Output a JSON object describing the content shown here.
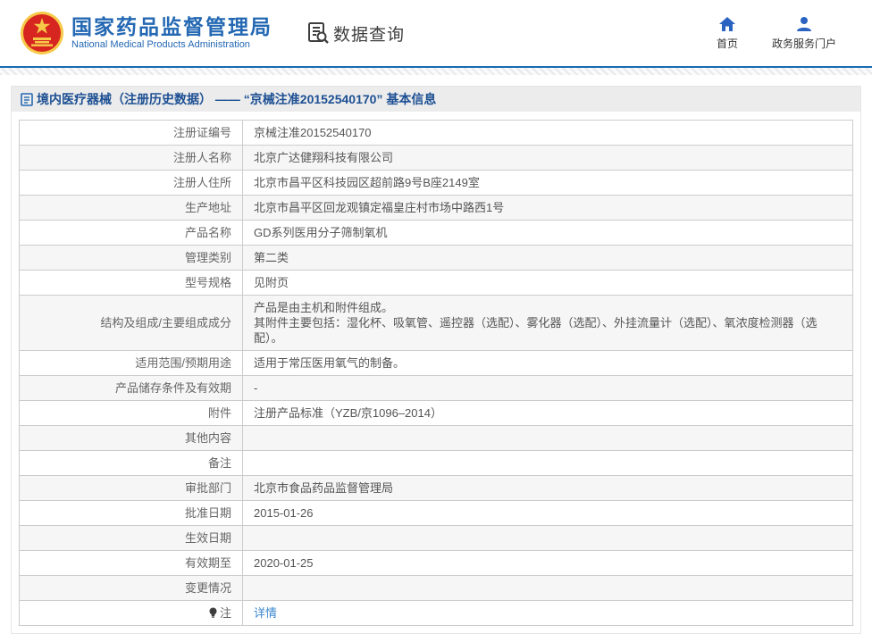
{
  "header": {
    "org_name_zh": "国家药品监督管理局",
    "org_name_en": "National Medical Products Administration",
    "section_title": "数据查询",
    "nav": [
      {
        "label": "首页",
        "icon": "home-icon"
      },
      {
        "label": "政务服务门户",
        "icon": "user-icon"
      }
    ]
  },
  "colors": {
    "brand_blue": "#2468b3",
    "divider_blue": "#1a6ab3",
    "title_blue": "#1c4f93",
    "link_blue": "#3a87cf",
    "emblem_red": "#d6261f",
    "emblem_gold": "#f7c948"
  },
  "page": {
    "title": "境内医疗器械（注册历史数据） —— “京械注准20152540170” 基本信息"
  },
  "table": {
    "rows": [
      {
        "label": "注册证编号",
        "values": [
          "京械注准20152540170"
        ]
      },
      {
        "label": "注册人名称",
        "values": [
          "北京广达健翔科技有限公司"
        ]
      },
      {
        "label": "注册人住所",
        "values": [
          "北京市昌平区科技园区超前路9号B座2149室"
        ]
      },
      {
        "label": "生产地址",
        "values": [
          "北京市昌平区回龙观镇定福皇庄村市场中路西1号"
        ]
      },
      {
        "label": "产品名称",
        "values": [
          "GD系列医用分子筛制氧机"
        ]
      },
      {
        "label": "管理类别",
        "values": [
          "第二类"
        ]
      },
      {
        "label": "型号规格",
        "values": [
          "见附页"
        ]
      },
      {
        "label": "结构及组成/主要组成成分",
        "values": [
          "产品是由主机和附件组成。",
          "其附件主要包括：湿化杯、吸氧管、遥控器（选配）、雾化器（选配）、外挂流量计（选配）、氧浓度检测器（选配）。"
        ]
      },
      {
        "label": "适用范围/预期用途",
        "values": [
          "适用于常压医用氧气的制备。"
        ]
      },
      {
        "label": "产品储存条件及有效期",
        "values": [
          "-"
        ]
      },
      {
        "label": "附件",
        "values": [
          "注册产品标准（YZB/京1096–2014）"
        ]
      },
      {
        "label": "其他内容",
        "values": [
          ""
        ]
      },
      {
        "label": "备注",
        "values": [
          ""
        ]
      },
      {
        "label": "审批部门",
        "values": [
          "北京市食品药品监督管理局"
        ]
      },
      {
        "label": "批准日期",
        "values": [
          "2015-01-26"
        ]
      },
      {
        "label": "生效日期",
        "values": [
          ""
        ]
      },
      {
        "label": "有效期至",
        "values": [
          "2020-01-25"
        ]
      },
      {
        "label": "变更情况",
        "values": [
          ""
        ]
      },
      {
        "label": "注",
        "values": [
          "详情"
        ],
        "is_link": true,
        "label_icon": "bulb-icon"
      }
    ]
  }
}
